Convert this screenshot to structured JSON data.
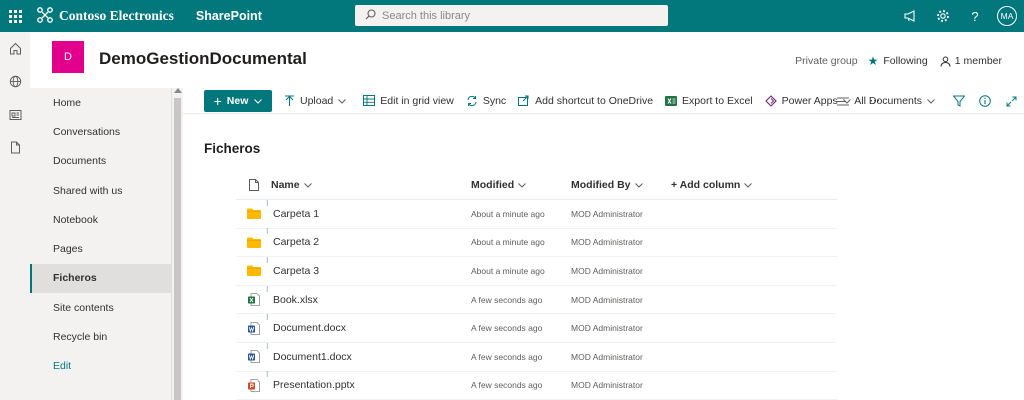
{
  "suite": {
    "brand_name": "Contoso Electronics",
    "app_name": "SharePoint",
    "search_placeholder": "Search this library",
    "user_initials": "MA",
    "icons": [
      "app-launcher-icon",
      "megaphone-icon",
      "gear-icon",
      "help-icon"
    ]
  },
  "appbar": {
    "icons": [
      "home-icon",
      "globe-icon",
      "news-icon",
      "document-icon"
    ]
  },
  "site": {
    "logo_letter": "D",
    "title": "DemoGestionDocumental",
    "privacy": "Private group",
    "following_label": "Following",
    "members_label": "1 member"
  },
  "nav": {
    "items": [
      {
        "label": "Home"
      },
      {
        "label": "Conversations"
      },
      {
        "label": "Documents"
      },
      {
        "label": "Shared with us"
      },
      {
        "label": "Notebook"
      },
      {
        "label": "Pages"
      },
      {
        "label": "Ficheros",
        "active": true
      },
      {
        "label": "Site contents"
      },
      {
        "label": "Recycle bin"
      },
      {
        "label": "Edit"
      }
    ]
  },
  "commands": {
    "new_label": "New",
    "upload_label": "Upload",
    "grid_label": "Edit in grid view",
    "sync_label": "Sync",
    "shortcut_label": "Add shortcut to OneDrive",
    "excel_label": "Export to Excel",
    "powerapps_label": "Power Apps",
    "more_label": "⋯",
    "view_label": "All Documents"
  },
  "library": {
    "title": "Ficheros",
    "columns": {
      "name": "Name",
      "modified": "Modified",
      "modified_by": "Modified By",
      "add_column": "+ Add column"
    },
    "rows": [
      {
        "name": "Carpeta 1",
        "type": "folder",
        "modified": "About a minute ago",
        "modified_by": "MOD Administrator"
      },
      {
        "name": "Carpeta 2",
        "type": "folder",
        "modified": "About a minute ago",
        "modified_by": "MOD Administrator"
      },
      {
        "name": "Carpeta 3",
        "type": "folder",
        "modified": "About a minute ago",
        "modified_by": "MOD Administrator"
      },
      {
        "name": "Book.xlsx",
        "type": "excel",
        "modified": "A few seconds ago",
        "modified_by": "MOD Administrator"
      },
      {
        "name": "Document.docx",
        "type": "word",
        "modified": "A few seconds ago",
        "modified_by": "MOD Administrator"
      },
      {
        "name": "Document1.docx",
        "type": "word",
        "modified": "A few seconds ago",
        "modified_by": "MOD Administrator"
      },
      {
        "name": "Presentation.pptx",
        "type": "powerpoint",
        "modified": "A few seconds ago",
        "modified_by": "MOD Administrator"
      }
    ]
  },
  "colors": {
    "theme": "#03787c",
    "site_logo": "#e3008c",
    "folder": "#ffb900",
    "excel": "#217346",
    "word": "#2b579a",
    "powerpoint": "#d24726"
  }
}
